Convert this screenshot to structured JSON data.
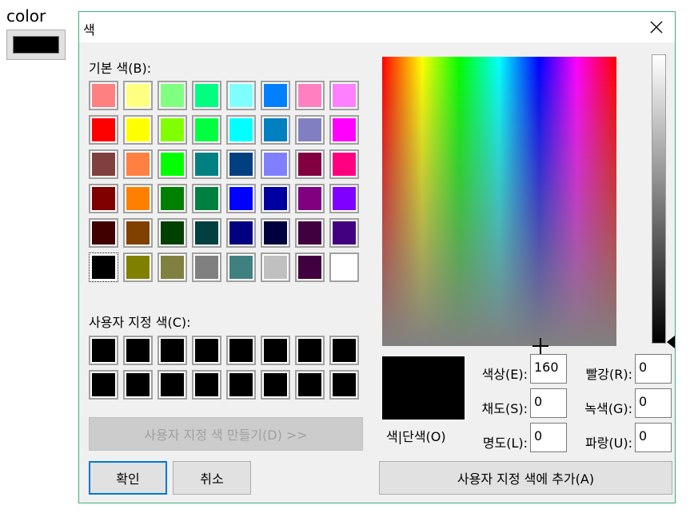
{
  "page": {
    "color_label": "color"
  },
  "dialog": {
    "title": "색",
    "basic_colors_label": "기본 색(B):",
    "custom_colors_label": "사용자 지정 색(C):",
    "define_custom_button": "사용자 지정 색 만들기(D) >>",
    "ok_button": "확인",
    "cancel_button": "취소",
    "add_custom_button": "사용자 지정 색에 추가(A)",
    "preview_label": "색|단색(O)",
    "fields": {
      "hue": {
        "label": "색상(E):",
        "value": "160"
      },
      "sat": {
        "label": "채도(S):",
        "value": "0"
      },
      "lum": {
        "label": "명도(L):",
        "value": "0"
      },
      "red": {
        "label": "빨강(R):",
        "value": "0"
      },
      "green": {
        "label": "녹색(G):",
        "value": "0"
      },
      "blue": {
        "label": "파랑(U):",
        "value": "0"
      }
    },
    "basic_colors": [
      "#ff8080",
      "#ffff80",
      "#80ff80",
      "#00ff80",
      "#80ffff",
      "#0080ff",
      "#ff80c0",
      "#ff80ff",
      "#ff0000",
      "#ffff00",
      "#80ff00",
      "#00ff40",
      "#00ffff",
      "#0080c0",
      "#8080c0",
      "#ff00ff",
      "#804040",
      "#ff8040",
      "#00ff00",
      "#008080",
      "#004080",
      "#8080ff",
      "#800040",
      "#ff0080",
      "#800000",
      "#ff8000",
      "#008000",
      "#008040",
      "#0000ff",
      "#0000a0",
      "#800080",
      "#8000ff",
      "#400000",
      "#804000",
      "#004000",
      "#004040",
      "#000080",
      "#000040",
      "#400040",
      "#400080",
      "#000000",
      "#808000",
      "#808040",
      "#808080",
      "#408080",
      "#c0c0c0",
      "#400040",
      "#ffffff"
    ],
    "selected_basic_index": 40,
    "custom_colors": [
      "#000000",
      "#000000",
      "#000000",
      "#000000",
      "#000000",
      "#000000",
      "#000000",
      "#000000",
      "#000000",
      "#000000",
      "#000000",
      "#000000",
      "#000000",
      "#000000",
      "#000000",
      "#000000"
    ],
    "preview_color": "#000000"
  }
}
